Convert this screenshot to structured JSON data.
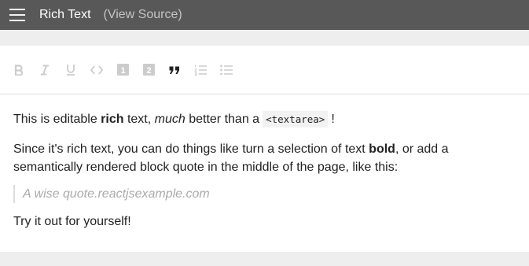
{
  "appbar": {
    "title": "Rich Text",
    "view_source_label": "(View Source)"
  },
  "icons": {
    "menu": "hamburger-menu-icon",
    "bold": "bold-icon",
    "italic": "italic-icon",
    "underline": "underline-icon",
    "code": "code-icon",
    "heading_one": "heading-one-icon",
    "heading_two": "heading-two-icon",
    "block_quote": "block-quote-icon",
    "numbered_list": "numbered-list-icon",
    "bulleted_list": "bulleted-list-icon"
  },
  "colors": {
    "appbar": "#585858",
    "icon_inactive": "#cccccc",
    "icon_active": "#222222",
    "quote_text": "#aaaaaa"
  },
  "toolbar": {
    "heading_one_label": "1",
    "heading_two_label": "2",
    "active_button": "block-quote"
  },
  "editor": {
    "p1": {
      "t1": "This is editable ",
      "bold": "rich",
      "t2": " text, ",
      "italic": "much",
      "t3": " better than a",
      "code": "<textarea>",
      "t4": "!"
    },
    "p2": {
      "t1": "Since it's rich text, you can do things like turn a selection of text ",
      "bold": "bold",
      "t2": ", or add a semantically rendered block quote in the middle of the page, like this:"
    },
    "quote": "A wise quote.reactjsexample.com",
    "p3": "Try it out for yourself!"
  }
}
